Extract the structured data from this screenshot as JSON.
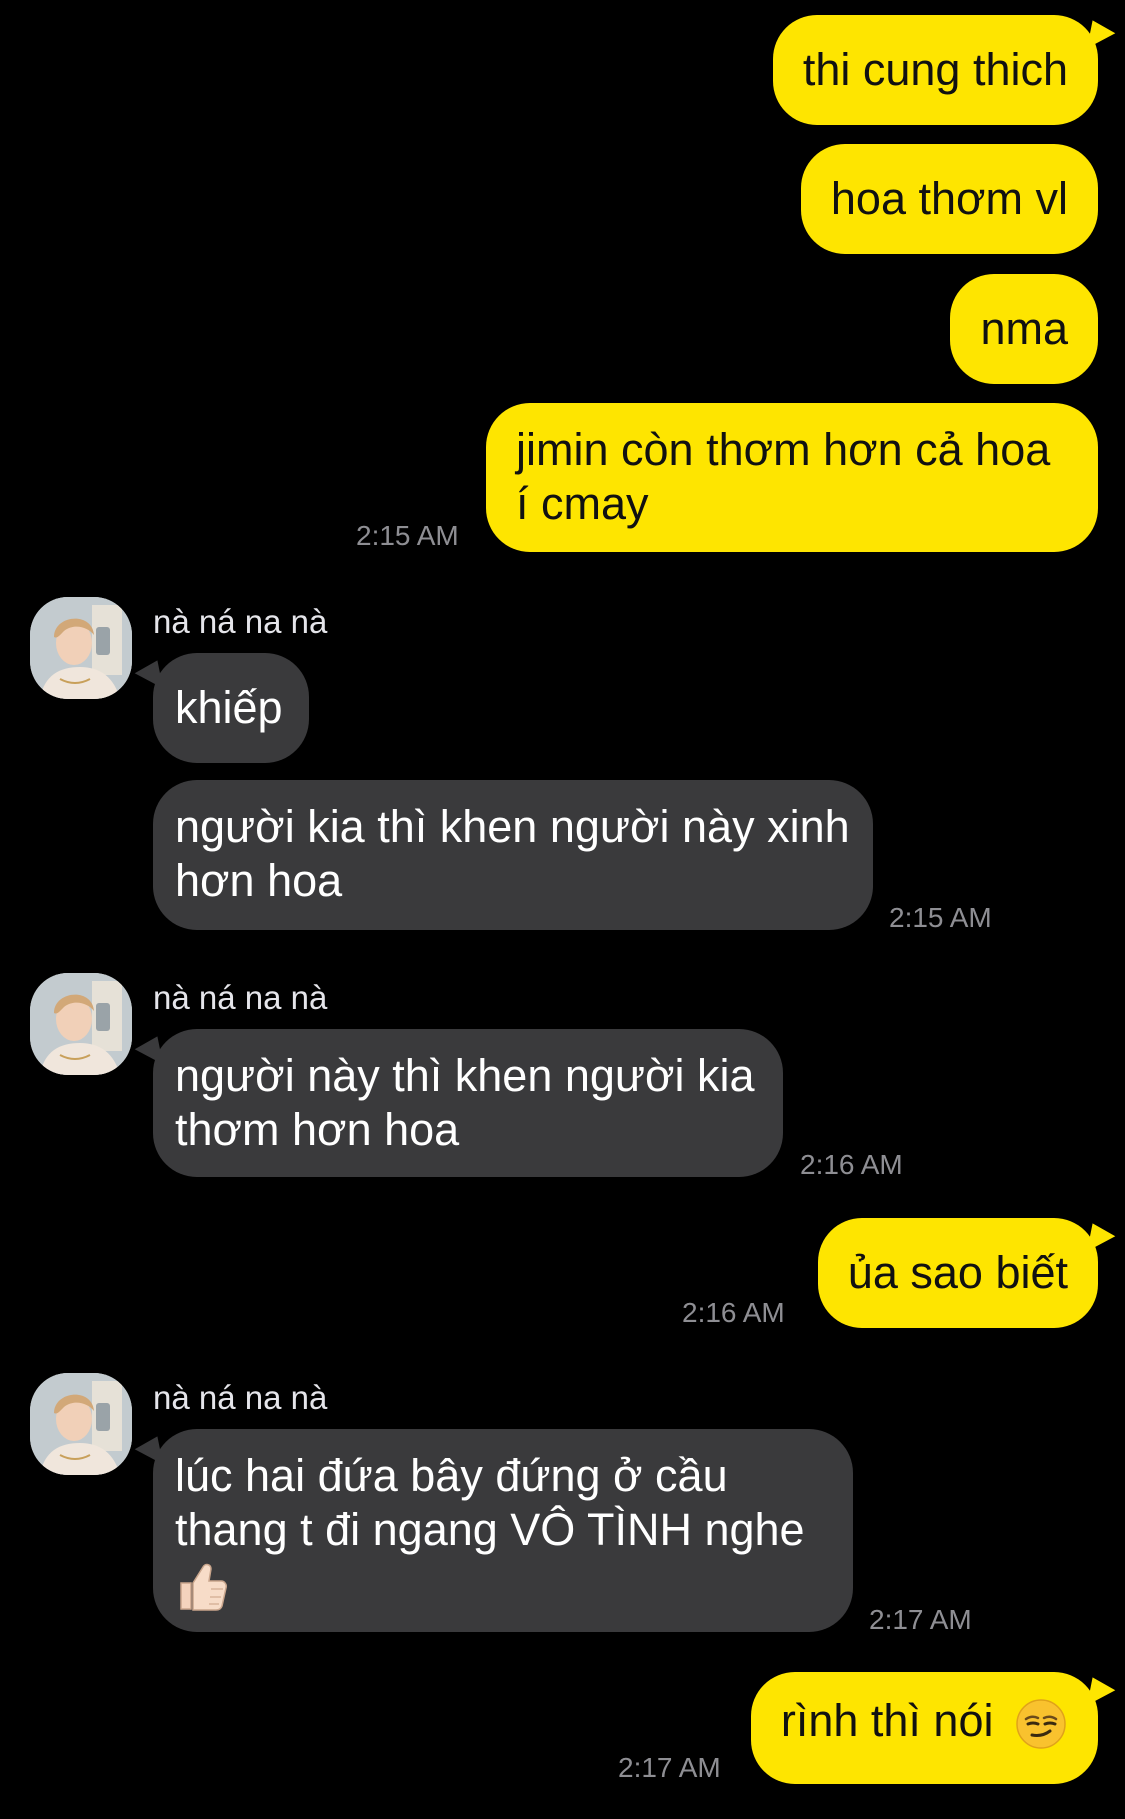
{
  "contact": {
    "name": "nà ná na nà"
  },
  "messages": {
    "m1": {
      "text": "thi cung thich"
    },
    "m2": {
      "text": "hoa thơm vl"
    },
    "m3": {
      "text": "nma"
    },
    "m4": {
      "line1": "jimin còn thơm hơn cả hoa",
      "line2": "í cmay",
      "time": "2:15 AM"
    },
    "m5": {
      "text": "khiếp"
    },
    "m6": {
      "line1": "người kia thì khen người này xinh",
      "line2": "hơn hoa",
      "time": "2:15 AM"
    },
    "m7": {
      "line1": "người này thì khen người kia",
      "line2": "thơm hơn hoa",
      "time": "2:16 AM"
    },
    "m8": {
      "text": "ủa sao biết",
      "time": "2:16 AM"
    },
    "m9": {
      "line1": "lúc hai đứa bây đứng ở cầu",
      "line2": "thang t đi ngang VÔ TÌNH nghe",
      "emoji": "thumbs-up-icon",
      "time": "2:17 AM"
    },
    "m10": {
      "text": "rình thì nói",
      "emoji": "smirking-face-icon",
      "time": "2:17 AM"
    }
  },
  "colors": {
    "background": "#000000",
    "sent_bubble": "#FEE500",
    "received_bubble": "#3A3A3C",
    "timestamp": "#8E8E93"
  }
}
